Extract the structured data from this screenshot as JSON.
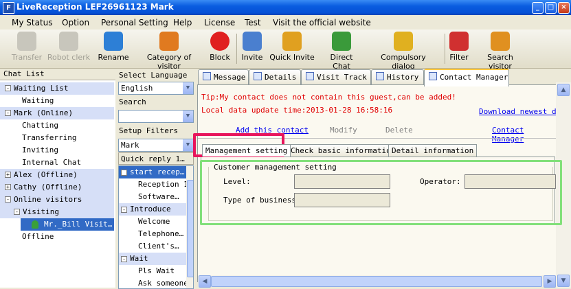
{
  "window": {
    "app_icon": "F",
    "title": "LiveReception   LEF26961123 Mark",
    "buttons": [
      "_",
      "□",
      "×"
    ]
  },
  "menu": [
    "My Status",
    "Option",
    "Personal Setting",
    "Help",
    "License",
    "Test",
    "Visit the official website"
  ],
  "toolbar": [
    {
      "label": "Transfer",
      "icon": "transfer-icon",
      "enabled": false,
      "color": "#9c9a90"
    },
    {
      "label": "Robot clerk",
      "icon": "robot-icon",
      "enabled": false,
      "color": "#9c9a90"
    },
    {
      "label": "Rename",
      "icon": "rename-icon",
      "enabled": true,
      "color": "#2d7fd6"
    },
    {
      "label": "Category of visitor",
      "icon": "category-icon",
      "enabled": true,
      "color": "#e07a20"
    },
    {
      "label": "Block",
      "icon": "block-icon",
      "enabled": true,
      "color": "#e02020"
    },
    {
      "label": "Invite",
      "icon": "invite-icon",
      "enabled": true,
      "color": "#4a7fcf"
    },
    {
      "label": "Quick Invite",
      "icon": "quick-invite-icon",
      "enabled": true,
      "color": "#e0a020"
    },
    {
      "label": "Direct Chat",
      "icon": "direct-chat-icon",
      "enabled": true,
      "color": "#3a9a3a"
    },
    {
      "label": "Compulsory dialog",
      "icon": "compulsory-dialog-icon",
      "enabled": true,
      "color": "#e0b020"
    },
    {
      "label": "Filter",
      "icon": "filter-icon",
      "enabled": true,
      "color": "#d03030"
    },
    {
      "label": "Search visitor",
      "icon": "search-visitor-icon",
      "enabled": true,
      "color": "#e09020"
    }
  ],
  "chat_list": {
    "header": "Chat List",
    "items": [
      {
        "text": "Waiting List",
        "type": "group",
        "exp": "-"
      },
      {
        "text": "Waiting",
        "type": "child"
      },
      {
        "text": "Mark (Online)",
        "type": "group",
        "exp": "-"
      },
      {
        "text": "Chatting",
        "type": "child"
      },
      {
        "text": "Transferring",
        "type": "child"
      },
      {
        "text": "Inviting",
        "type": "child"
      },
      {
        "text": "Internal Chat",
        "type": "child"
      },
      {
        "text": "Alex (Offline)",
        "type": "group",
        "exp": "+"
      },
      {
        "text": "Cathy (Offline)",
        "type": "group",
        "exp": "+"
      },
      {
        "text": "Online visitors",
        "type": "group",
        "exp": "-"
      },
      {
        "text": "Visiting",
        "type": "subgroup",
        "exp": "-"
      },
      {
        "text": "Mr._Bill  Visit…",
        "type": "visitor"
      },
      {
        "text": "Offline",
        "type": "child"
      }
    ]
  },
  "middle": {
    "language_label": "Select Language",
    "language_value": "English",
    "search_label": "Search",
    "search_value": "",
    "filters_label": "Setup Filters",
    "filters_value": "Mark",
    "quick_reply_header": "Quick reply 1…",
    "quick_reply": [
      {
        "text": "start recep…",
        "type": "group",
        "exp": "-",
        "selected": true
      },
      {
        "text": "Reception 1",
        "type": "child"
      },
      {
        "text": "Software…",
        "type": "child"
      },
      {
        "text": "Introduce",
        "type": "group",
        "exp": "-"
      },
      {
        "text": "Welcome",
        "type": "child"
      },
      {
        "text": "Telephone…",
        "type": "child"
      },
      {
        "text": "Client's…",
        "type": "child"
      },
      {
        "text": "Wait",
        "type": "group",
        "exp": "-"
      },
      {
        "text": "Pls Wait",
        "type": "child"
      },
      {
        "text": "Ask someone…",
        "type": "child"
      }
    ]
  },
  "tabs": [
    "Message",
    "Details",
    "Visit Track",
    "History",
    "Contact Manager"
  ],
  "contact_manager": {
    "tip": "Tip:My contact does not contain this guest,can be added!",
    "update_time": "Local data update time:2013-01-28 16:58:16",
    "download_link": "Download newest dat",
    "add_contact": "Add this contact",
    "modify": "Modify",
    "delete": "Delete",
    "contact_manager_link": "Contact Manager",
    "subtabs": [
      "Management setting",
      "Check basic information",
      "Detail information"
    ],
    "panel_title": "Customer management setting",
    "level_label": "Level:",
    "operator_label": "Operator:",
    "business_label": "Type of business:"
  }
}
